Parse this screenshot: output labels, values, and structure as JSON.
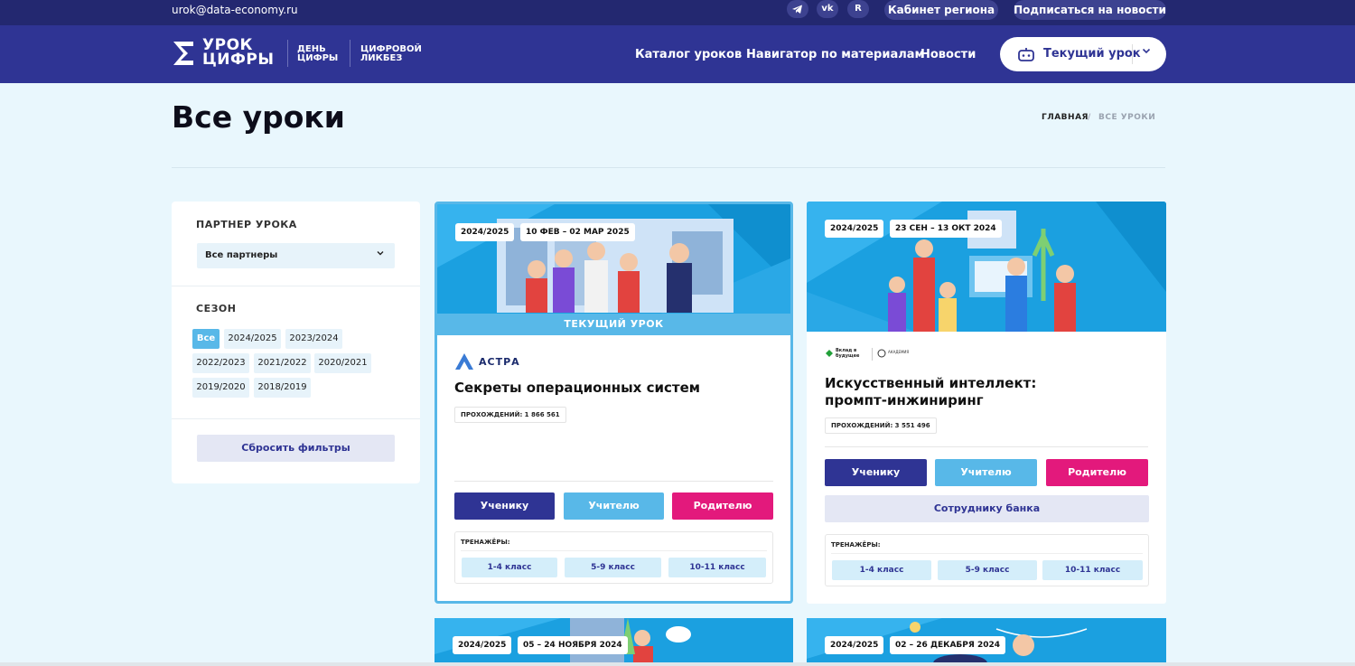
{
  "topbar": {
    "email": "urok@data-economy.ru",
    "social_icons": [
      "telegram-icon",
      "vk-icon",
      "rutube-icon"
    ],
    "region_cabinet": "Кабинет региона",
    "subscribe": "Подписаться на новости"
  },
  "header": {
    "logo_line1": "УРОК",
    "logo_line2": "ЦИФРЫ",
    "sub1_line1": "ДЕНЬ",
    "sub1_line2": "ЦИФРЫ",
    "sub2_line1": "ЦИФРОВОЙ",
    "sub2_line2": "ЛИКБЕЗ",
    "nav": [
      "Каталог уроков",
      "Навигатор по материалам",
      "Новости"
    ],
    "current_lesson": "Текущий урок"
  },
  "page": {
    "title": "Все уроки",
    "breadcrumb_home": "ГЛАВНАЯ",
    "breadcrumb_sep": "/",
    "breadcrumb_current": "ВСЕ УРОКИ"
  },
  "filters": {
    "partner_label": "ПАРТНЕР УРОКА",
    "partner_value": "Все партнеры",
    "season_label": "СЕЗОН",
    "seasons": [
      "Все",
      "2024/2025",
      "2023/2024",
      "2022/2023",
      "2021/2022",
      "2020/2021",
      "2019/2020",
      "2018/2019"
    ],
    "selected_season": "Все",
    "reset": "Сбросить фильтры"
  },
  "cards": [
    {
      "season": "2024/2025",
      "dates": "10 ФЕВ – 02 МАР 2025",
      "current_label": "ТЕКУЩИЙ УРОК",
      "partner": "АСТРА",
      "title": "Секреты операционных систем",
      "passes": "ПРОХОЖДЕНИЙ: 1 866 561",
      "roles": [
        "Ученику",
        "Учителю",
        "Родителю"
      ],
      "trainers_label": "ТРЕНАЖЁРЫ:",
      "grades": [
        "1-4 класс",
        "5-9 класс",
        "10-11 класс"
      ]
    },
    {
      "season": "2024/2025",
      "dates": "23 СЕН – 13 ОКТ 2024",
      "partner": "Вклад в будущее",
      "partner2": "АКАДЕМИЯ",
      "title_line1": "Искусственный интеллект:",
      "title_line2": "промпт-инжиниринг",
      "passes": "ПРОХОЖДЕНИЙ: 3 551 496",
      "roles": [
        "Ученику",
        "Учителю",
        "Родителю"
      ],
      "bank": "Сотруднику банка",
      "trainers_label": "ТРЕНАЖЁРЫ:",
      "grades": [
        "1-4 класс",
        "5-9 класс",
        "10-11 класс"
      ]
    },
    {
      "season": "2024/2025",
      "dates": "05 – 24 НОЯБРЯ 2024"
    },
    {
      "season": "2024/2025",
      "dates": "02 – 26 ДЕКАБРЯ 2024"
    }
  ],
  "colors": {
    "header": "#2f3494",
    "topbar": "#232870",
    "accent_blue": "#58b8e8",
    "accent_pink": "#e3197c",
    "page_bg": "#e9f7fd"
  }
}
